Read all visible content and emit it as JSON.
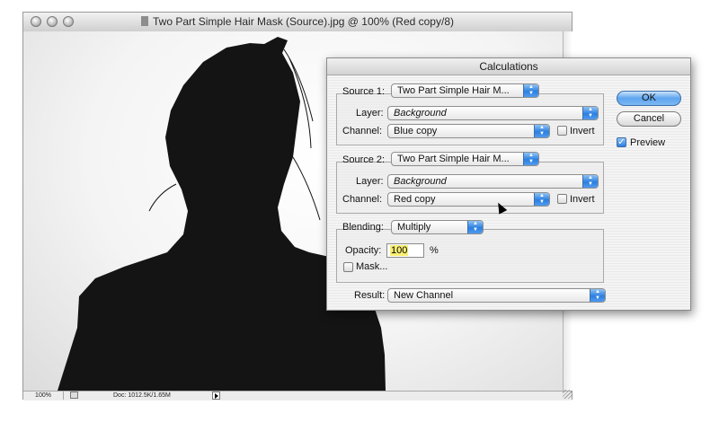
{
  "document_window": {
    "title": "Two Part Simple Hair Mask (Source).jpg @ 100% (Red copy/8)",
    "zoom": "100%",
    "doc_size": "Doc: 1012.5K/1.65M"
  },
  "dialog": {
    "title": "Calculations",
    "source1": {
      "legend": "Source 1:",
      "file": "Two Part Simple Hair M...",
      "layer_label": "Layer:",
      "layer": "Background",
      "channel_label": "Channel:",
      "channel": "Blue copy",
      "invert_label": "Invert",
      "invert_checked": false
    },
    "source2": {
      "legend": "Source 2:",
      "file": "Two Part Simple Hair M...",
      "layer_label": "Layer:",
      "layer": "Background",
      "channel_label": "Channel:",
      "channel": "Red copy",
      "invert_label": "Invert",
      "invert_checked": false
    },
    "blending": {
      "label": "Blending:",
      "mode": "Multiply",
      "opacity_label": "Opacity:",
      "opacity": "100",
      "percent": "%",
      "mask_label": "Mask...",
      "mask_checked": false
    },
    "result": {
      "label": "Result:",
      "value": "New Channel"
    },
    "buttons": {
      "ok": "OK",
      "cancel": "Cancel"
    },
    "preview": {
      "label": "Preview",
      "checked": true
    }
  },
  "colors": {
    "accent_blue": "#2c7fe0",
    "opacity_highlight": "#f8ef74",
    "silhouette": "#141414"
  }
}
